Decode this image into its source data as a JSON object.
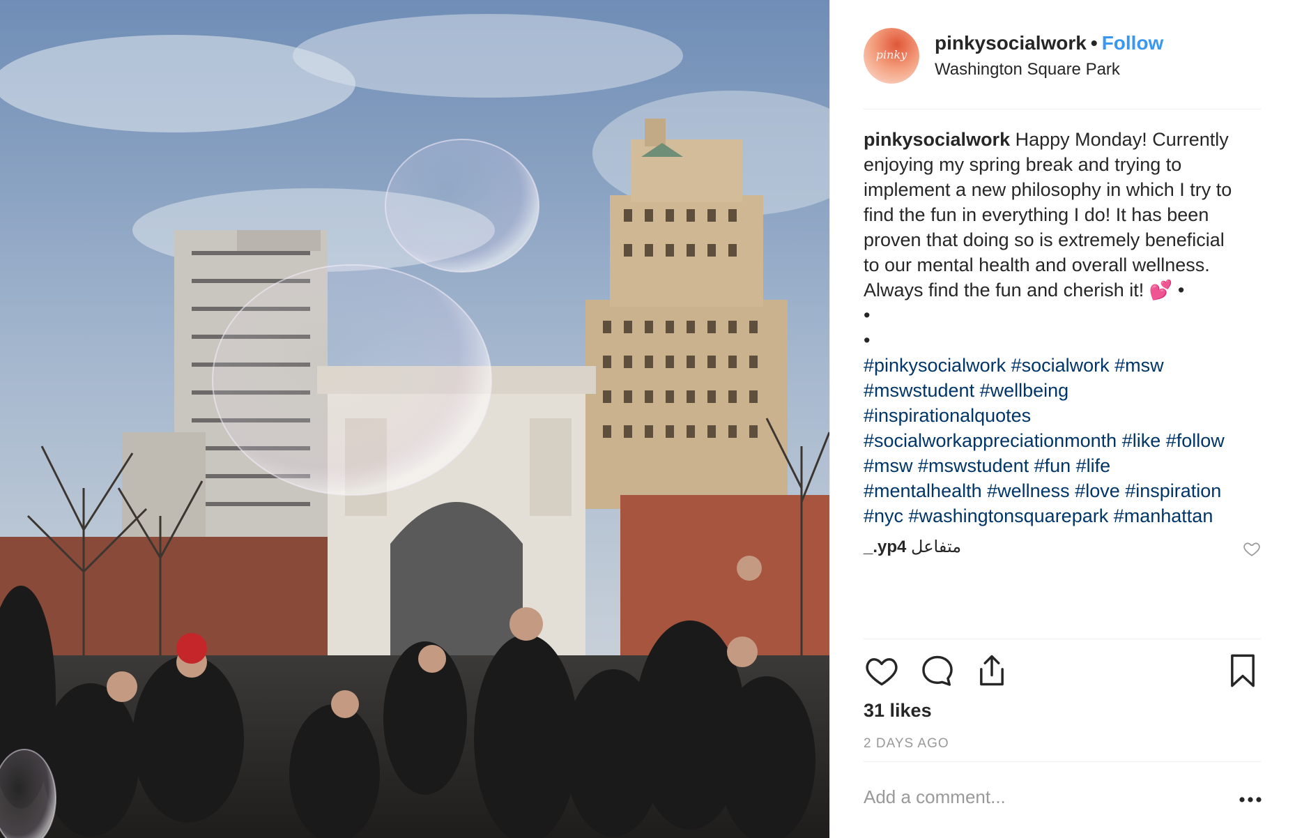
{
  "post": {
    "username": "pinkysocialwork",
    "separator": "•",
    "follow_label": "Follow",
    "location": "Washington Square Park",
    "avatar_text": "pinky",
    "caption_user": "pinkysocialwork",
    "caption_lines": [
      " Happy Monday! Currently",
      "enjoying my spring break and trying to",
      "implement a new philosophy in which I try to",
      "find the fun in everything I do! It has been",
      "proven that doing so is extremely beneficial",
      "to our mental health and overall wellness.",
      "Always find the fun and cherish it! 💕  •",
      "•",
      "•"
    ],
    "hashtag_lines": [
      "#pinkysocialwork #socialwork #msw",
      "#mswstudent #wellbeing",
      "#inspirationalquotes",
      "#socialworkappreciationmonth #like #follow",
      "#msw #mswstudent #fun #life",
      "#mentalhealth #wellness #love #inspiration",
      "#nyc #washingtonsquarepark #manhattan"
    ],
    "comment": {
      "user": "_.yp4",
      "text": "متفاعل"
    },
    "likes": "31 likes",
    "date": "2 DAYS AGO",
    "add_comment_placeholder": "Add a comment..."
  },
  "colors": {
    "link_blue": "#3897f0",
    "hashtag_blue": "#003569",
    "text": "#262626",
    "muted": "#999999"
  },
  "icons": [
    "heart-icon",
    "comment-icon",
    "share-icon",
    "bookmark-icon",
    "more-icon"
  ]
}
